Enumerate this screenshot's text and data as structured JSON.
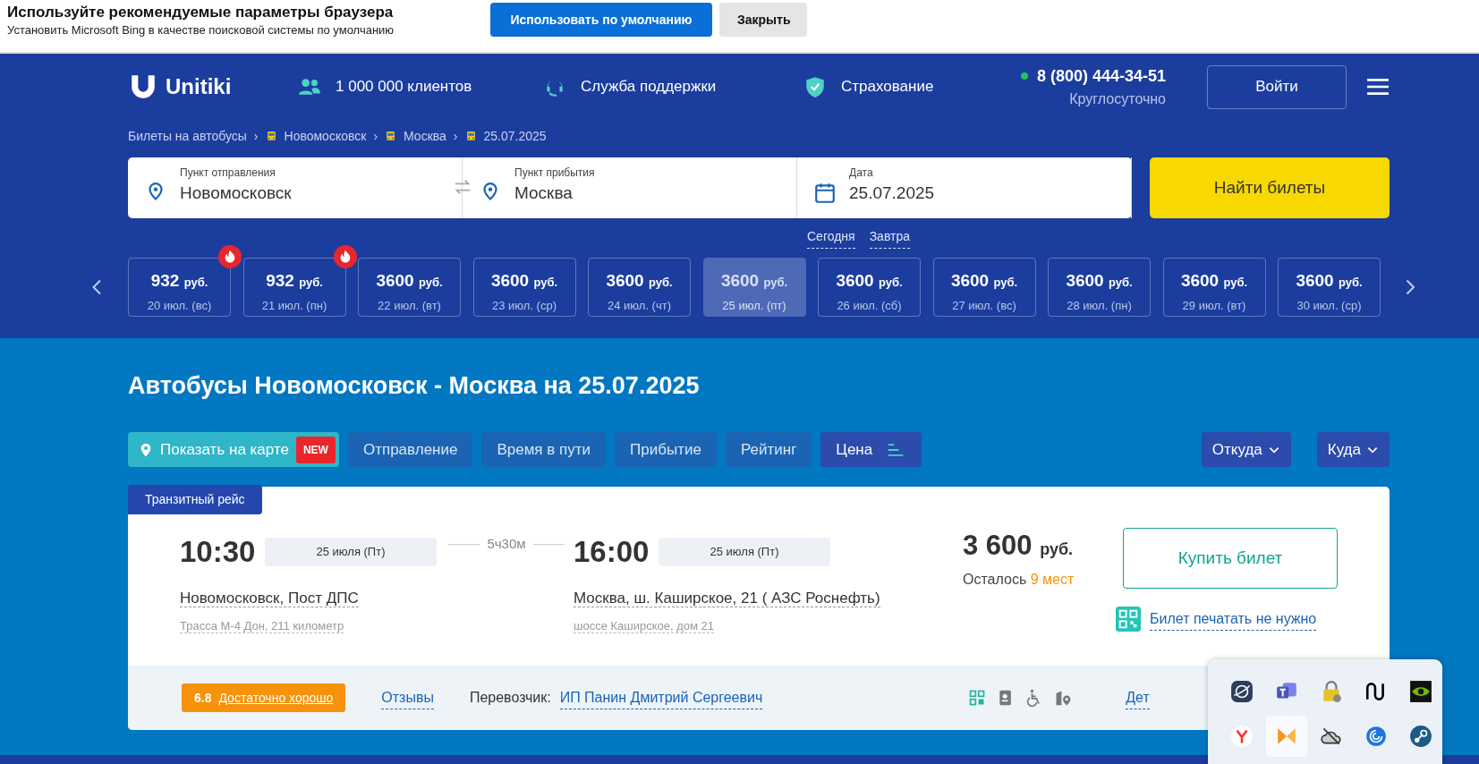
{
  "browser_prompt": {
    "title": "Используйте рекомендуемые параметры браузера",
    "subtitle": "Установить Microsoft Bing в качестве поисковой системы по умолчанию",
    "buttons": [
      {
        "label": "Использовать по умолчанию",
        "kind": "primary"
      },
      {
        "label": "Закрыть",
        "kind": "secondary"
      }
    ]
  },
  "header": {
    "logo": "Unitiki",
    "features": [
      {
        "kind": "people",
        "label": "1 000 000 клиентов"
      },
      {
        "kind": "support",
        "label": "Служба поддержки"
      },
      {
        "kind": "shield",
        "label": "Страхование"
      }
    ],
    "phone": "8 (800) 444-34-51",
    "online": true,
    "phone_note": "Круглосуточно",
    "login": "Войти"
  },
  "breadcrumbs": [
    {
      "label": "Билеты на автобусы",
      "bus": false
    },
    {
      "separator": "›",
      "label": "Новомосковск",
      "bus": true
    },
    {
      "separator": "›",
      "label": "Москва",
      "bus": true
    },
    {
      "separator": "›",
      "label": "25.07.2025",
      "bus": true
    }
  ],
  "search": {
    "fields": [
      {
        "kind": "from",
        "label": "Пункт отправления",
        "value": "Новомосковск"
      },
      {
        "kind": "to",
        "label": "Пункт прибытия",
        "value": "Москва"
      },
      {
        "kind": "date",
        "label": "Дата",
        "value": "25.07.2025"
      }
    ],
    "button": "Найти билеты",
    "quick_dates": [
      "Сегодня",
      "Завтра"
    ]
  },
  "date_prices": [
    {
      "price": "932",
      "currency": "руб.",
      "date": "20 июл. (вс)",
      "hot": true,
      "selected": false
    },
    {
      "price": "932",
      "currency": "руб.",
      "date": "21 июл. (пн)",
      "hot": true,
      "selected": false
    },
    {
      "price": "3600",
      "currency": "руб.",
      "date": "22 июл. (вт)",
      "hot": false,
      "selected": false
    },
    {
      "price": "3600",
      "currency": "руб.",
      "date": "23 июл. (ср)",
      "hot": false,
      "selected": false
    },
    {
      "price": "3600",
      "currency": "руб.",
      "date": "24 июл. (чт)",
      "hot": false,
      "selected": false
    },
    {
      "price": "3600",
      "currency": "руб.",
      "date": "25 июл. (пт)",
      "hot": false,
      "selected": true
    },
    {
      "price": "3600",
      "currency": "руб.",
      "date": "26 июл. (сб)",
      "hot": false,
      "selected": false
    },
    {
      "price": "3600",
      "currency": "руб.",
      "date": "27 июл. (вс)",
      "hot": false,
      "selected": false
    },
    {
      "price": "3600",
      "currency": "руб.",
      "date": "28 июл. (пн)",
      "hot": false,
      "selected": false
    },
    {
      "price": "3600",
      "currency": "руб.",
      "date": "29 июл. (вт)",
      "hot": false,
      "selected": false
    },
    {
      "price": "3600",
      "currency": "руб.",
      "date": "30 июл. (ср)",
      "hot": false,
      "selected": false
    }
  ],
  "results": {
    "title": "Автобусы Новомосковск - Москва на 25.07.2025",
    "sort_buttons": [
      {
        "kind": "map",
        "label": "Показать на карте",
        "badge": "NEW",
        "selected": false
      },
      {
        "kind": "sort",
        "label": "Отправление",
        "selected": false
      },
      {
        "kind": "sort",
        "label": "Время в пути",
        "selected": false
      },
      {
        "kind": "sort",
        "label": "Прибытие",
        "selected": false
      },
      {
        "kind": "sort",
        "label": "Рейтинг",
        "selected": false
      },
      {
        "kind": "sort",
        "label": "Цена",
        "selected": true
      }
    ],
    "filters": [
      "Откуда",
      "Куда"
    ]
  },
  "trips": [
    {
      "badge": "Транзитный рейс",
      "dep_time": "10:30",
      "dep_date": "25 июля (Пт)",
      "duration": "5ч30м",
      "arr_time": "16:00",
      "arr_date": "25 июля (Пт)",
      "dep_place": "Новомосковск, Пост ДПС",
      "dep_address": "Трасса М-4 Дон, 211 километр",
      "arr_place": "Москва, ш. Каширское, 21 ( АЗС Роснефть)",
      "arr_address": "шоссе Каширское, дом 21",
      "price": "3 600",
      "currency": "руб.",
      "seats_label": "Осталось",
      "seats": "9 мест",
      "buy": "Купить билет",
      "no_print": "Билет печатать не нужно",
      "rating": "6.8",
      "rating_label": "Достаточно хорошо",
      "reviews": "Отзывы",
      "carrier_label": "Перевозчик:",
      "carrier": "ИП Панин Дмитрий Сергеевич",
      "amenities": [
        {
          "kind": "qr"
        },
        {
          "kind": "document"
        },
        {
          "kind": "wheelchair"
        },
        {
          "kind": "pin"
        }
      ],
      "details": "Дет"
    }
  ],
  "tray": {
    "icons": [
      {
        "kind": "globe",
        "hovered": false
      },
      {
        "kind": "chat",
        "hovered": false
      },
      {
        "kind": "padlock",
        "hovered": false
      },
      {
        "kind": "wave",
        "hovered": false
      },
      {
        "kind": "eye",
        "hovered": false
      },
      {
        "kind": "letter",
        "hovered": false
      },
      {
        "kind": "arrows",
        "hovered": true
      },
      {
        "kind": "cloud",
        "hovered": false
      },
      {
        "kind": "spiral",
        "hovered": false
      },
      {
        "kind": "steam",
        "hovered": false
      }
    ]
  }
}
